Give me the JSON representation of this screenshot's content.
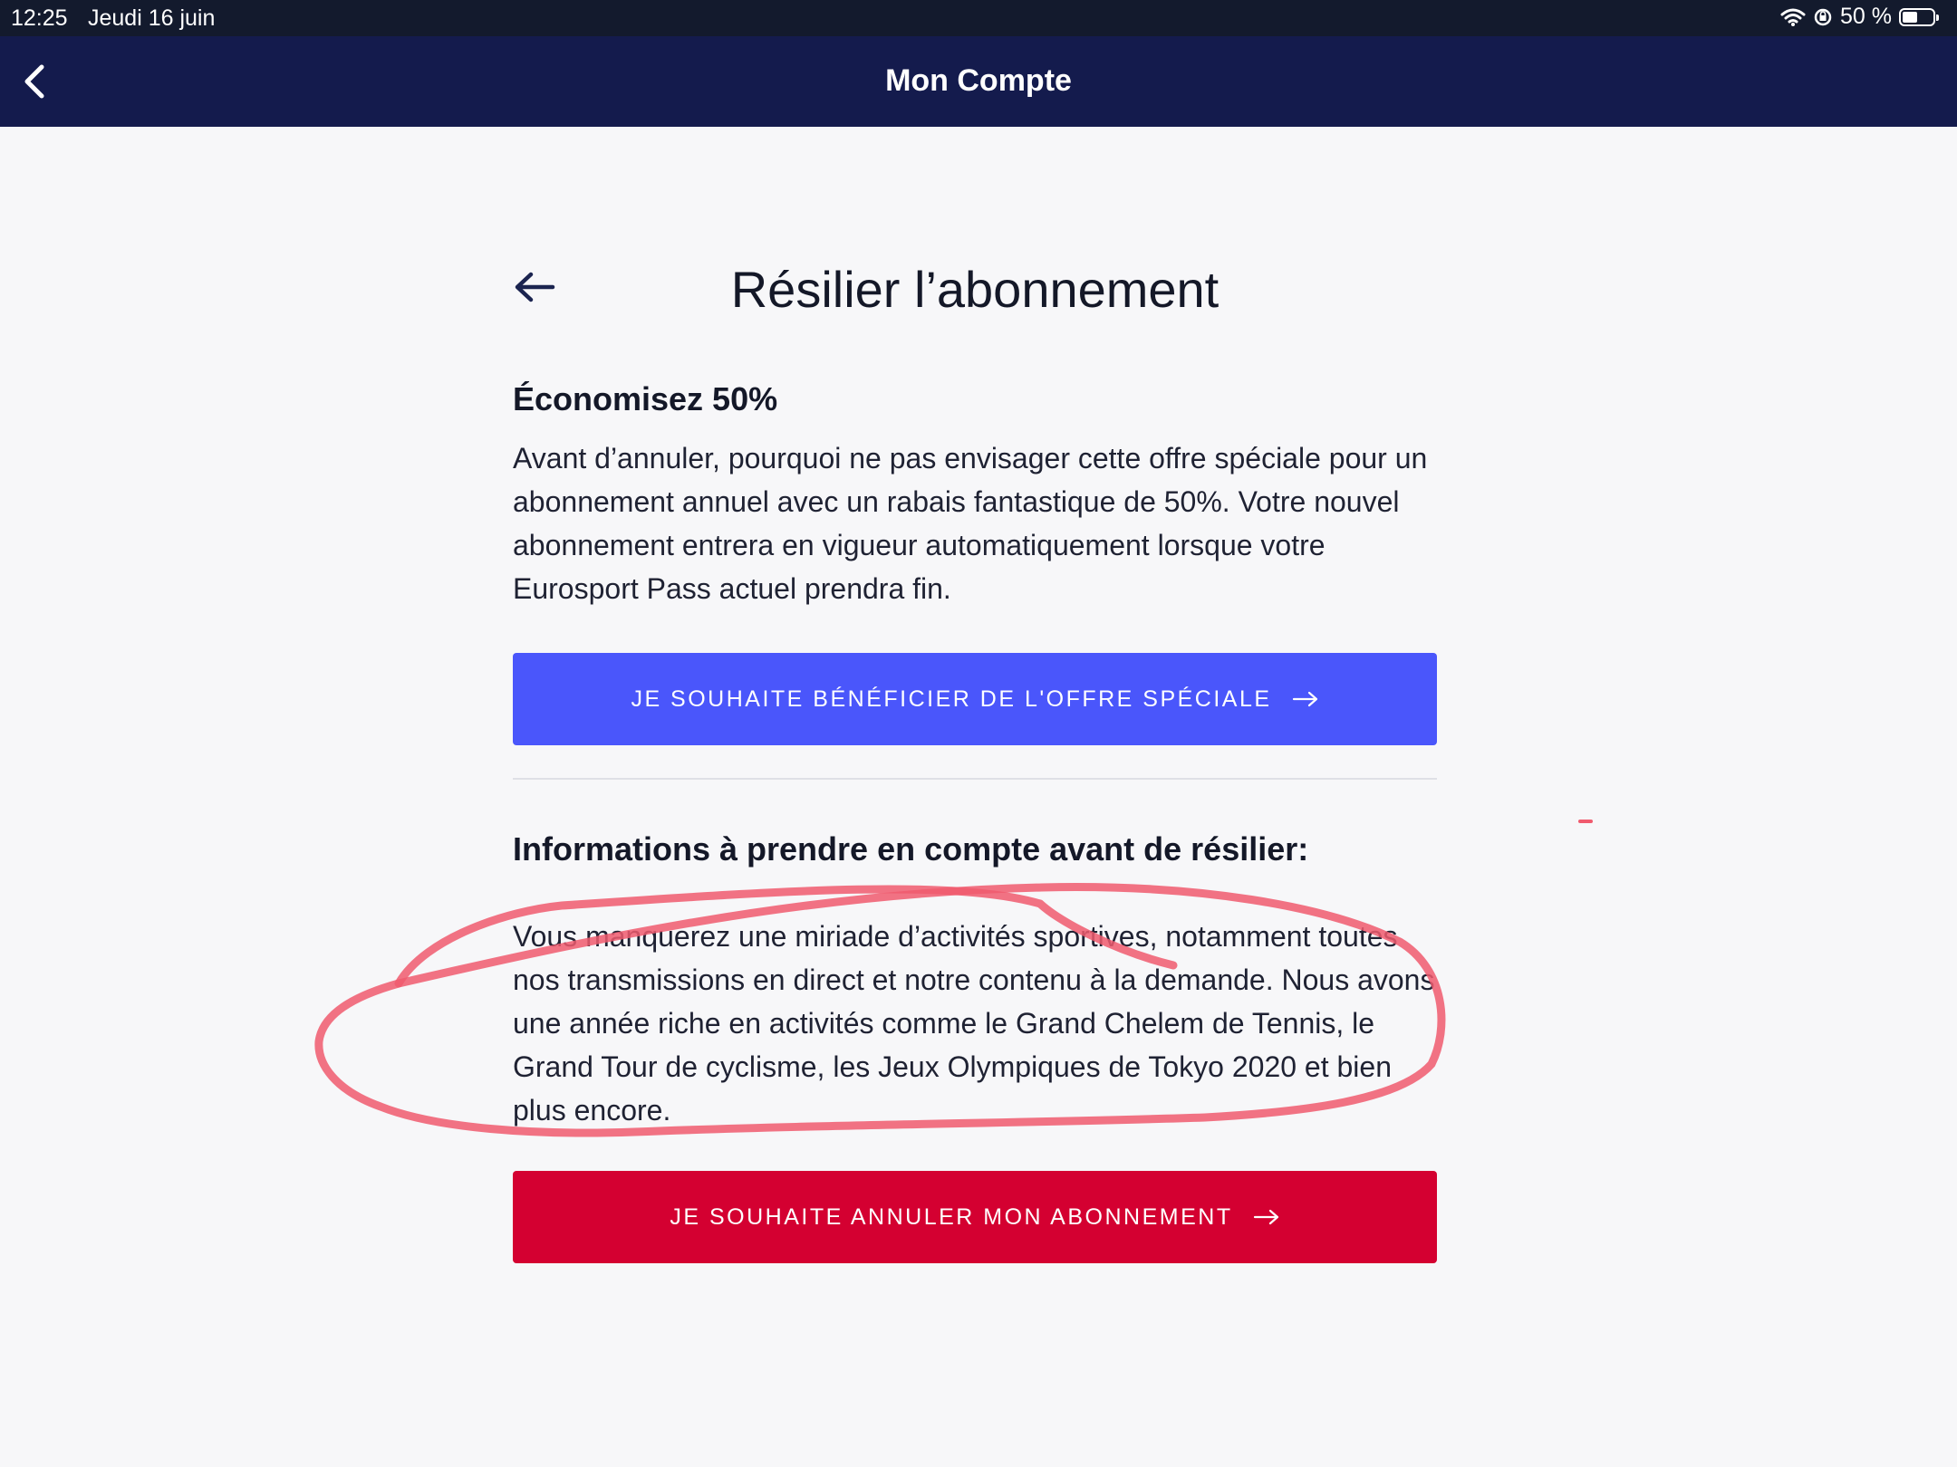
{
  "status_bar": {
    "time": "12:25",
    "date": "Jeudi 16 juin",
    "battery": "50 %",
    "battery_level": 0.5,
    "icons": [
      "wifi-icon",
      "orientation-lock-icon",
      "battery-icon"
    ]
  },
  "nav": {
    "title": "Mon Compte",
    "back_icon": "chevron-left-icon"
  },
  "page": {
    "title": "Résilier l’abonnement",
    "back_icon": "arrow-left-icon"
  },
  "offer": {
    "heading": "Économisez 50%",
    "body": "Avant d’annuler, pourquoi ne pas envisager cette offre spéciale pour un abonnement annuel avec un rabais fantastique de 50%. Votre nouvel abonnement entrera en vigueur automatiquement lorsque votre Eurosport Pass actuel prendra fin.",
    "button_label": "JE SOUHAITE BÉNÉFICIER DE L'OFFRE SPÉCIALE",
    "button_icon": "arrow-right-icon",
    "button_color": "#4a56fb"
  },
  "info": {
    "heading": "Informations à prendre en compte avant de résilier:",
    "body": "Vous manquerez une miriade d’activités sportives, notamment toutes nos transmissions en direct et notre contenu à la demande. Nous avons une année riche en activités comme le Grand Chelem de Tennis, le Grand Tour de cyclisme, les Jeux Olympiques de Tokyo 2020 et bien plus encore.",
    "button_label": "JE SOUHAITE ANNULER MON ABONNEMENT",
    "button_icon": "arrow-right-icon",
    "button_color": "#d40031"
  },
  "colors": {
    "nav_background": "#141b4d",
    "status_background": "#131a2d",
    "page_background": "#f7f7f9",
    "annotation": "#f05a6e"
  }
}
